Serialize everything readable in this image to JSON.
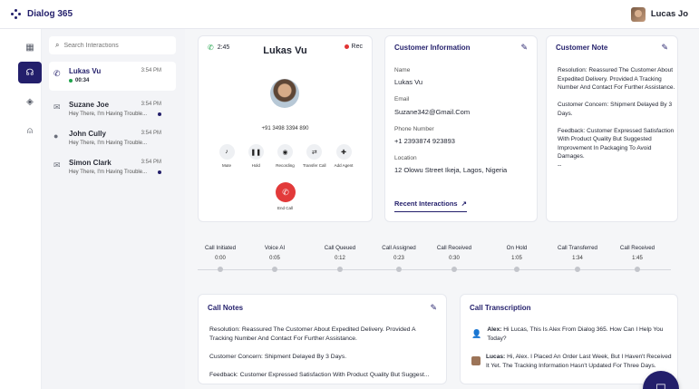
{
  "app": {
    "brand": "Dialog 365",
    "user_name": "Lucas Jo"
  },
  "rail": {
    "items": [
      {
        "icon": "grid-icon"
      },
      {
        "icon": "headset-icon",
        "active": true
      },
      {
        "icon": "layers-icon"
      },
      {
        "icon": "user-icon"
      }
    ]
  },
  "search": {
    "placeholder": "Search Interactions"
  },
  "interactions": [
    {
      "name": "Lukas Vu",
      "time": "3:54 PM",
      "sub": "00:34",
      "icon": "phone-icon",
      "active": true
    },
    {
      "name": "Suzane Joe",
      "time": "3:54 PM",
      "sub": "Hey There, I'm Having Trouble...",
      "icon": "mail-icon"
    },
    {
      "name": "John Cully",
      "time": "3:54 PM",
      "sub": "Hey There, I'm Having Trouble...",
      "icon": "chat-icon"
    },
    {
      "name": "Simon Clark",
      "time": "3:54 PM",
      "sub": "Hey There, I'm Having Trouble...",
      "icon": "mail-icon"
    }
  ],
  "call": {
    "duration": "2:45",
    "rec_label": "Rec",
    "caller_name": "Lukas Vu",
    "caller_number": "+91 3498 3394 890",
    "actions": [
      {
        "label": "Mute",
        "icon": "mic-icon"
      },
      {
        "label": "Hold",
        "icon": "pause-icon"
      },
      {
        "label": "Recording",
        "icon": "record-icon"
      },
      {
        "label": "Transfer Call",
        "icon": "transfer-icon"
      },
      {
        "label": "Add Agent",
        "icon": "add-agent-icon"
      }
    ],
    "end_label": "End Call"
  },
  "customer_info": {
    "title": "Customer Information",
    "name_label": "Name",
    "name": "Lukas Vu",
    "email_label": "Email",
    "email": "Suzane342@Gmail.Com",
    "phone_label": "Phone Number",
    "phone": "+1 2393874 923893",
    "location_label": "Location",
    "location": "12 Olowu Street Ikeja, Lagos, Nigeria",
    "recent_label": "Recent Interactions"
  },
  "customer_note": {
    "title": "Customer Note",
    "paragraphs": [
      "Resolution: Reassured The Customer About Expedited Delivery. Provided A Tracking Number And Contact For Further Assistance.",
      "Customer Concern: Shipment Delayed By 3 Days.",
      "Feedback: Customer Expressed Satisfaction With Product Quality But Suggested Improvement In Packaging To Avoid Damages.",
      "--"
    ]
  },
  "timeline": [
    {
      "label": "Call Initiated",
      "time": "0:00"
    },
    {
      "label": "Voice AI",
      "time": "0:05"
    },
    {
      "label": "Call Queued",
      "time": "0:12"
    },
    {
      "label": "Call Assigned",
      "time": "0:23"
    },
    {
      "label": "Call Received",
      "time": "0:30"
    },
    {
      "label": "On Hold",
      "time": "1:05"
    },
    {
      "label": "Call Transferred",
      "time": "1:34"
    },
    {
      "label": "Call Received",
      "time": "1:45"
    }
  ],
  "call_notes": {
    "title": "Call Notes",
    "lines": [
      "Resolution: Reassured The Customer About Expedited Delivery. Provided A",
      "Tracking Number And Contact For Further Assistance.",
      "Customer Concern: Shipment Delayed By 3 Days.",
      "Feedback: Customer Expressed Satisfaction With Product Quality But Suggest..."
    ]
  },
  "transcript": {
    "title": "Call Transcription",
    "messages": [
      {
        "speaker": "Alex:",
        "text": "Hi Lucas, This Is Alex From Dialog 365. How Can I Help You Today?"
      },
      {
        "speaker": "Lucas:",
        "text": "Hi, Alex. I Placed An Order Last Week, But I Haven't Received It Yet. The Tracking Information Hasn't Updated For Three Days."
      }
    ]
  }
}
